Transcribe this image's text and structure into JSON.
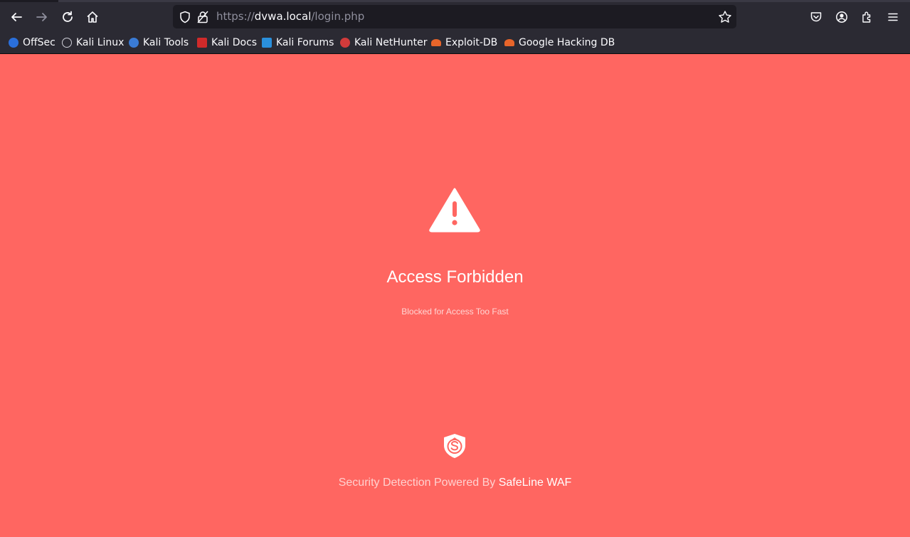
{
  "browser": {
    "url_prefix": "https://",
    "url_host": "dvwa.local",
    "url_path": "/login.php",
    "bookmarks": [
      {
        "label": "OffSec",
        "icon": "offsec-icon",
        "color": "#2a6fdb"
      },
      {
        "label": "Kali Linux",
        "icon": "kali-dragon-icon",
        "color": "#1a1a1a"
      },
      {
        "label": "Kali Tools",
        "icon": "kali-tools-icon",
        "color": "#3a7bd5"
      },
      {
        "label": "Kali Docs",
        "icon": "kali-docs-icon",
        "color": "#d02a2a"
      },
      {
        "label": "Kali Forums",
        "icon": "kali-forums-icon",
        "color": "#2a8fdb"
      },
      {
        "label": "Kali NetHunter",
        "icon": "nethunter-icon",
        "color": "#d23b3b"
      },
      {
        "label": "Exploit-DB",
        "icon": "exploitdb-icon",
        "color": "#e8652a"
      },
      {
        "label": "Google Hacking DB",
        "icon": "ghdb-icon",
        "color": "#e8652a"
      }
    ]
  },
  "page": {
    "title": "Access Forbidden",
    "subtitle": "Blocked for Access Too Fast",
    "footer_text": "Security Detection Powered By",
    "footer_brand": "SafeLine WAF",
    "background": "#ff6661"
  }
}
